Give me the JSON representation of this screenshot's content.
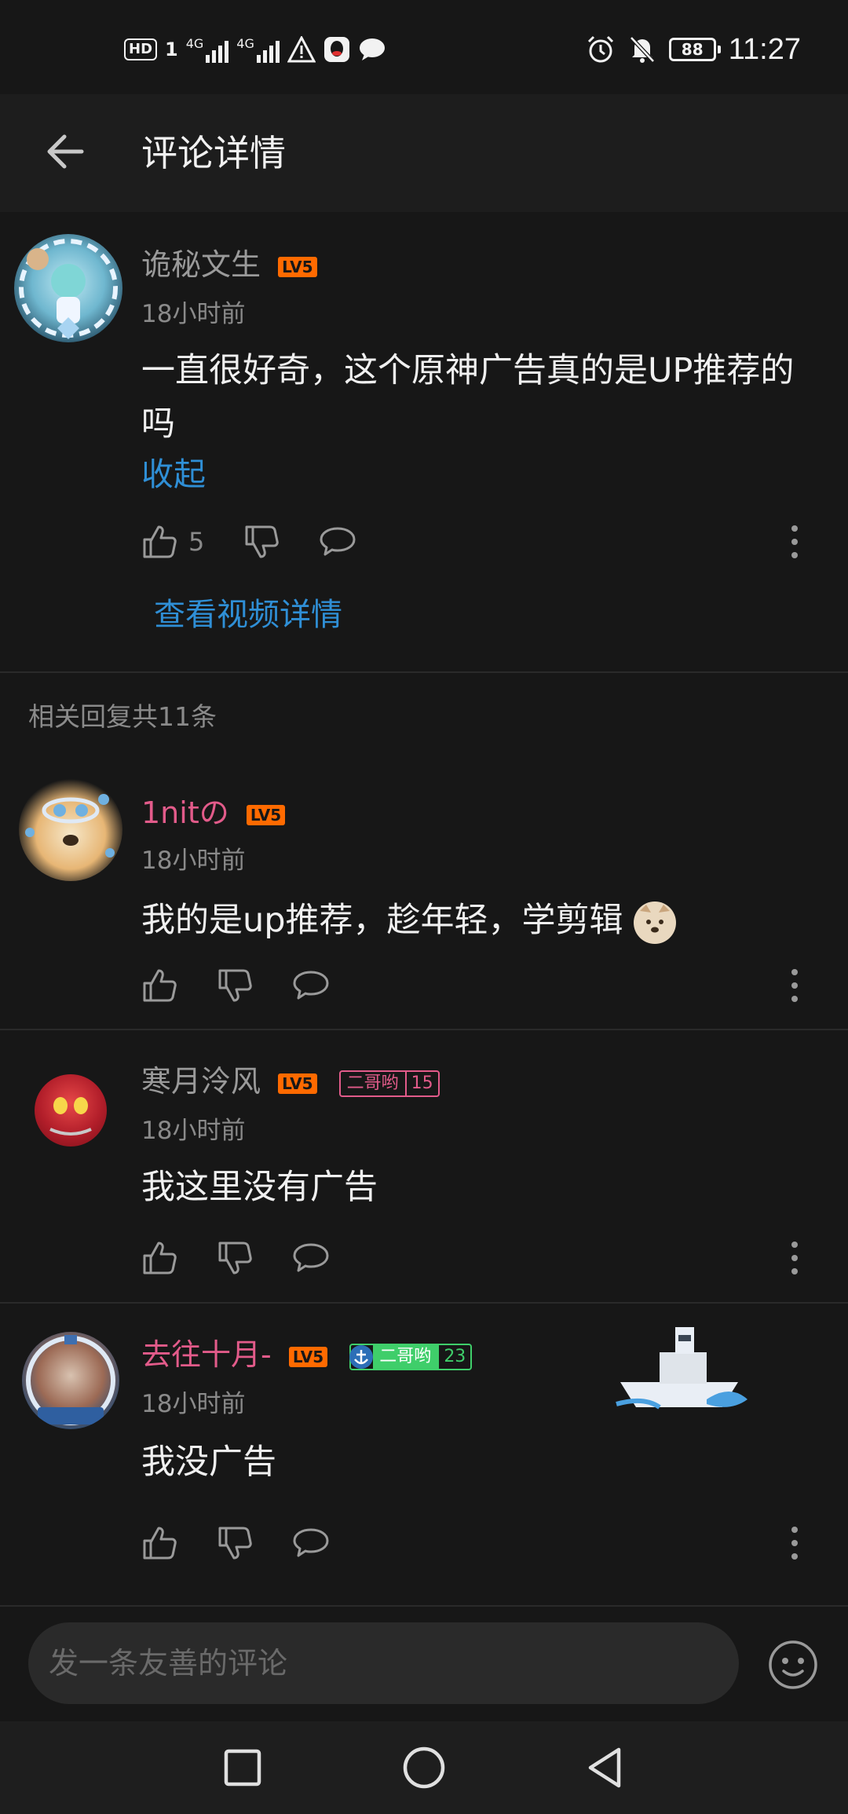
{
  "status_bar": {
    "hd_label": "HD",
    "sim_label": "1",
    "net1": "4G",
    "net2": "4G",
    "battery": "88",
    "time": "11:27"
  },
  "header": {
    "title": "评论详情"
  },
  "main_comment": {
    "username": "诡秘文生",
    "level": "LV5",
    "time": "18小时前",
    "content": "一直很好奇，这个原神广告真的是UP推荐的吗",
    "collapse_label": "收起",
    "like_count": "5",
    "view_video_label": "查看视频详情"
  },
  "replies_label": "相关回复共11条",
  "replies": [
    {
      "username": "1nitの",
      "username_color": "#e25b8a",
      "level": "LV5",
      "time": "18小时前",
      "content": "我的是up推荐，趁年轻，学剪辑"
    },
    {
      "username": "寒月泠风",
      "username_color": "#9a9a9a",
      "level": "LV5",
      "fan_badge_name": "二哥哟",
      "fan_badge_level": "15",
      "time": "18小时前",
      "content": "我这里没有广告"
    },
    {
      "username": "去往十月-",
      "username_color": "#e25b8a",
      "level": "LV5",
      "fan_badge_name": "二哥哟",
      "fan_badge_level": "23",
      "time": "18小时前",
      "content": "我没广告"
    }
  ],
  "comment_bar": {
    "placeholder": "发一条友善的评论"
  },
  "colors": {
    "background": "#171717",
    "accent_blue": "#2f8fd6",
    "level_orange": "#ff6a00",
    "vip_pink": "#e25b8a"
  }
}
